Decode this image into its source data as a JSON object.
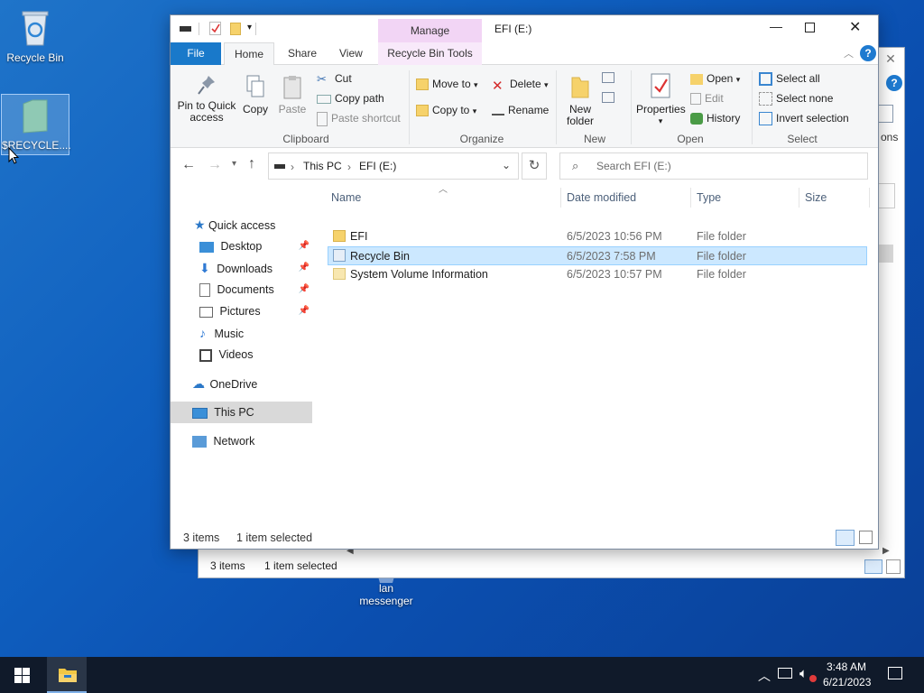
{
  "desktop": {
    "recycle_bin_label": "Recycle Bin",
    "selected_icon_label": "$RECYCLE....",
    "messenger_label_1": "lan",
    "messenger_label_2": "messenger"
  },
  "back_window": {
    "items_count": "3 items",
    "selected": "1 item selected",
    "partial_text": "ons"
  },
  "window": {
    "title": "EFI (E:)",
    "context_tab": "Manage",
    "tabs": [
      "File",
      "Home",
      "Share",
      "View",
      "Recycle Bin Tools"
    ],
    "ribbon": {
      "clipboard": {
        "pin": "Pin to Quick\naccess",
        "copy": "Copy",
        "paste": "Paste",
        "cut": "Cut",
        "copy_path": "Copy path",
        "paste_shortcut": "Paste shortcut",
        "group": "Clipboard"
      },
      "organize": {
        "move_to": "Move to",
        "copy_to": "Copy to",
        "delete": "Delete",
        "rename": "Rename",
        "group": "Organize"
      },
      "new": {
        "new_folder": "New\nfolder",
        "group": "New"
      },
      "open": {
        "properties": "Properties",
        "open": "Open",
        "edit": "Edit",
        "history": "History",
        "group": "Open"
      },
      "select": {
        "select_all": "Select all",
        "select_none": "Select none",
        "invert": "Invert selection",
        "group": "Select"
      }
    },
    "address": {
      "crumbs": [
        "This PC",
        "EFI (E:)"
      ],
      "search_placeholder": "Search EFI (E:)"
    },
    "nav": {
      "quick_access": "Quick access",
      "desktop": "Desktop",
      "downloads": "Downloads",
      "documents": "Documents",
      "pictures": "Pictures",
      "music": "Music",
      "videos": "Videos",
      "onedrive": "OneDrive",
      "this_pc": "This PC",
      "network": "Network"
    },
    "columns": {
      "name": "Name",
      "date": "Date modified",
      "type": "Type",
      "size": "Size"
    },
    "files": [
      {
        "name": "EFI",
        "date": "6/5/2023 10:56 PM",
        "type": "File folder"
      },
      {
        "name": "Recycle Bin",
        "date": "6/5/2023 7:58 PM",
        "type": "File folder"
      },
      {
        "name": "System Volume Information",
        "date": "6/5/2023 10:57 PM",
        "type": "File folder"
      }
    ],
    "status": {
      "items": "3 items",
      "selected": "1 item selected"
    }
  },
  "taskbar": {
    "time": "3:48 AM",
    "date": "6/21/2023"
  }
}
